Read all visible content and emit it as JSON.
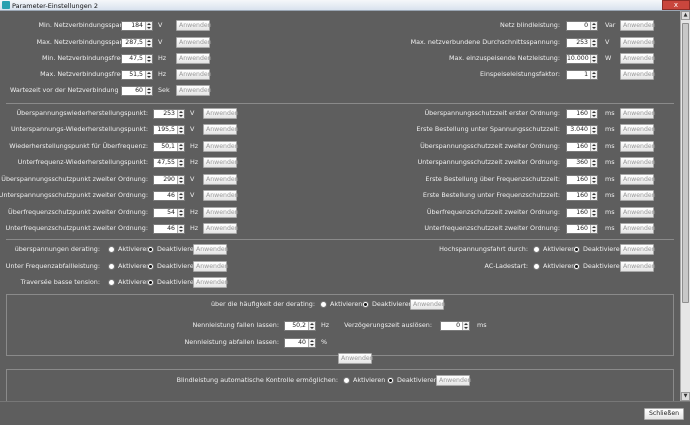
{
  "window": {
    "title": "Parameter-Einstellungen 2",
    "close": "x"
  },
  "apply": "Anwenden",
  "aktivieren": "Aktivieren",
  "deaktivieren": "Deaktivieren",
  "top_left": [
    {
      "label": "Min. Netzverbindungsspannung:",
      "value": "184",
      "unit": "V"
    },
    {
      "label": "Max. Netzverbindungsspannung:",
      "value": "287,5",
      "unit": "V"
    },
    {
      "label": "Min. Netzverbindungsfrequenz:",
      "value": "47,5",
      "unit": "Hz"
    },
    {
      "label": "Max. Netzverbindungsfrequenz:",
      "value": "51,5",
      "unit": "Hz"
    },
    {
      "label": "Wartezeit vor der Netzverbindung",
      "value": "60",
      "unit": "Sek"
    }
  ],
  "top_right": [
    {
      "label": "Netz blindleistung:",
      "value": "0",
      "unit": "Var"
    },
    {
      "label": "Max. netzverbundene Durchschnittsspannung:",
      "value": "253",
      "unit": "V"
    },
    {
      "label": "Max. einzuspeisende Netzleistung:",
      "value": "10.000",
      "unit": "W"
    },
    {
      "label": "Einspeiseleistungsfaktor:",
      "value": "1",
      "unit": ""
    }
  ],
  "mid_left": [
    {
      "label": "Überspannungswiederherstellungspunkt:",
      "value": "253",
      "unit": "V"
    },
    {
      "label": "Unterspannungs-Wiederherstellungspunkt:",
      "value": "195,5",
      "unit": "V"
    },
    {
      "label": "Wiederherstellungspunkt für Überfrequenz:",
      "value": "50,1",
      "unit": "Hz"
    },
    {
      "label": "Unterfrequenz-Wiederherstellungspunkt:",
      "value": "47,55",
      "unit": "Hz"
    },
    {
      "label": "Überspannungsschutzpunkt zweiter Ordnung:",
      "value": "290",
      "unit": "V"
    },
    {
      "label": "Unterspannungsschutzpunkt zweiter Ordnung:",
      "value": "46",
      "unit": "V"
    },
    {
      "label": "Überfrequenzschutzpunkt zweiter Ordnung:",
      "value": "54",
      "unit": "Hz"
    },
    {
      "label": "Unterfrequenzschutzpunkt zweiter Ordnung:",
      "value": "46",
      "unit": "Hz"
    }
  ],
  "mid_right": [
    {
      "label": "Überspannungsschutzzeit erster Ordnung:",
      "value": "160",
      "unit": "ms"
    },
    {
      "label": "Erste Bestellung unter Spannungsschutzzeit:",
      "value": "3.040",
      "unit": "ms"
    },
    {
      "label": "Überspannungsschutzzeit zweiter Ordnung:",
      "value": "160",
      "unit": "ms"
    },
    {
      "label": "Unterspannungsschutzzeit zweiter Ordnung:",
      "value": "360",
      "unit": "ms"
    },
    {
      "label": "Erste Bestellung über Frequenzschutzzeit:",
      "value": "160",
      "unit": "ms"
    },
    {
      "label": "Erste Bestellung unter Frequenzschutzzeit:",
      "value": "160",
      "unit": "ms"
    },
    {
      "label": "Überfrequenzschutzzeit zweiter Ordnung:",
      "value": "160",
      "unit": "ms"
    },
    {
      "label": "Unterfrequenzschutzzeit zweiter Ordnung:",
      "value": "160",
      "unit": "ms"
    }
  ],
  "radios_left": [
    {
      "label": "überspannungen derating:",
      "selected": "deaktivieren"
    },
    {
      "label": "Unter Frequenzabfallleistung:",
      "selected": "deaktivieren"
    },
    {
      "label": "Traversée basse tension:",
      "selected": "deaktivieren"
    }
  ],
  "radios_right": [
    {
      "label": "Hochspannungsfahrt durch:",
      "selected": "deaktivieren"
    },
    {
      "label": "AC-Ladestart:",
      "selected": "deaktivieren"
    }
  ],
  "derating": {
    "label": "über die häufigkeit der derating:",
    "selected": "deaktivieren",
    "nennleistung_fallen": {
      "label": "Nennleistung fallen lassen:",
      "value": "50,2",
      "unit": "Hz"
    },
    "verzoegerung": {
      "label": "Verzögerungszeit auslösen:",
      "value": "0",
      "unit": "ms"
    },
    "nennleistung_abfallen": {
      "label": "Nennleistung abfallen lassen:",
      "value": "40",
      "unit": "%"
    }
  },
  "blindleistung": {
    "label": "Blindleistung automatische Kontrolle ermöglichen:",
    "selected": "deaktivieren"
  },
  "footer": {
    "close": "Schließen"
  }
}
